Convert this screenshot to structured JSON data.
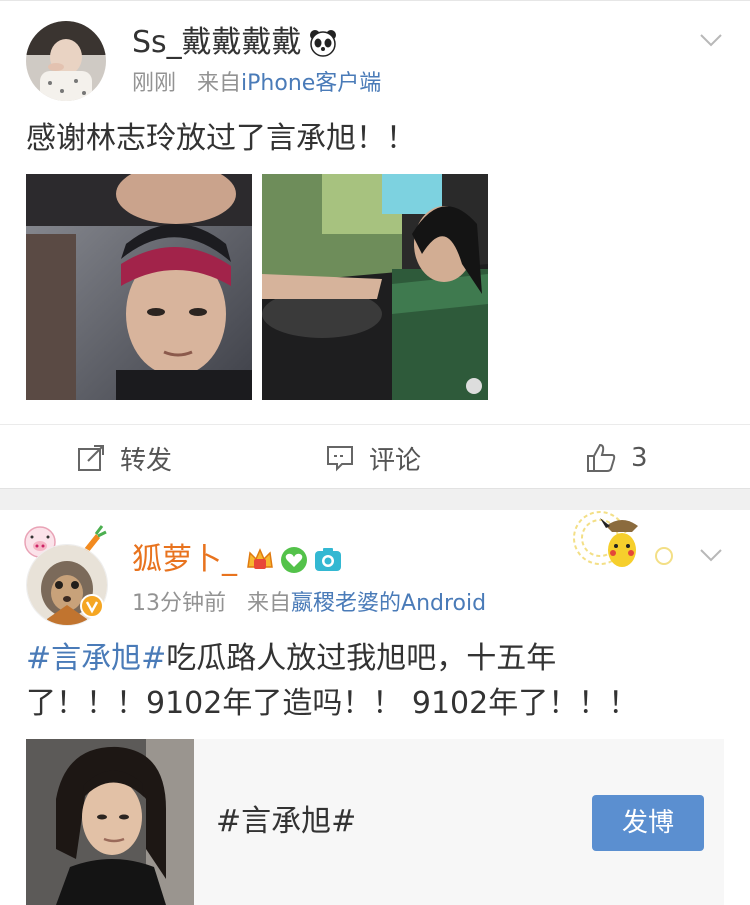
{
  "post1": {
    "username": "Ss_戴戴戴戴",
    "time": "刚刚",
    "from_prefix": "来自",
    "source": "iPhone客户端",
    "text": "感谢林志玲放过了言承旭！！",
    "repost_label": "转发",
    "comment_label": "评论",
    "like_count": "3"
  },
  "post2": {
    "username": "狐萝卜_",
    "time": "13分钟前",
    "from_prefix": "来自",
    "source": "嬴稷老婆的Android",
    "text_hashtag": "#言承旭#",
    "text_line1_rest": "吃瓜路人放过我旭吧，十五年",
    "text_line2": "了！！！9102年了造吗！！ 9102年了！！！",
    "card_topic": "#言承旭#",
    "card_button": "发博"
  },
  "colors": {
    "link": "#4a7bb8",
    "vip_name": "#e8731e",
    "button": "#5b8fd0",
    "separator": "#f0f0f0"
  },
  "icons": [
    "panda-icon",
    "chevron-down-icon",
    "repost-icon",
    "comment-icon",
    "like-icon",
    "crown-badge-icon",
    "heart-badge-icon",
    "camera-badge-icon",
    "verified-badge-icon",
    "pikachu-sticker"
  ]
}
